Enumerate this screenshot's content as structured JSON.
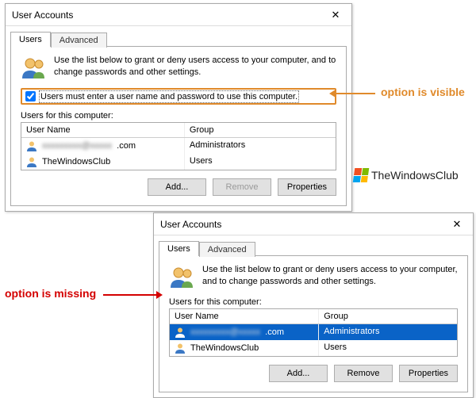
{
  "dialog1": {
    "title": "User Accounts",
    "tabs": {
      "users": "Users",
      "advanced": "Advanced"
    },
    "desc": "Use the list below to grant or deny users access to your computer, and to change passwords and other settings.",
    "checkbox_label": "Users must enter a user name and password to use this computer.",
    "section": "Users for this computer:",
    "cols": {
      "name": "User Name",
      "group": "Group"
    },
    "rows": [
      {
        "name_suffix": ".com",
        "group": "Administrators"
      },
      {
        "name": "TheWindowsClub",
        "group": "Users"
      }
    ],
    "buttons": {
      "add": "Add...",
      "remove": "Remove",
      "props": "Properties"
    }
  },
  "dialog2": {
    "title": "User Accounts",
    "tabs": {
      "users": "Users",
      "advanced": "Advanced"
    },
    "desc": "Use the list below to grant or deny users access to your computer, and to change passwords and other settings.",
    "section": "Users for this computer:",
    "cols": {
      "name": "User Name",
      "group": "Group"
    },
    "rows": [
      {
        "name_suffix": ".com",
        "group": "Administrators"
      },
      {
        "name": "TheWindowsClub",
        "group": "Users"
      }
    ],
    "buttons": {
      "add": "Add...",
      "remove": "Remove",
      "props": "Properties"
    }
  },
  "annotations": {
    "visible": "option is visible",
    "missing": "option is missing"
  },
  "watermark": "TheWindowsClub"
}
